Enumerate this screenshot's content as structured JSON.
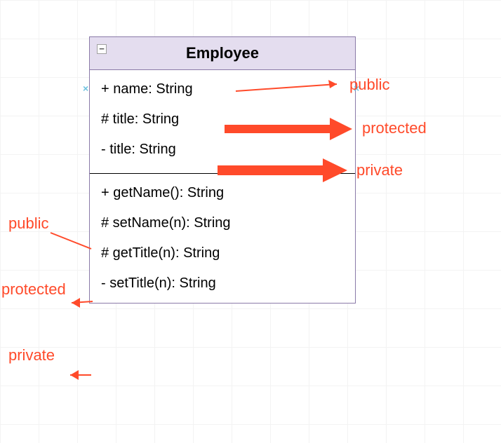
{
  "class": {
    "name": "Employee",
    "attributes": [
      {
        "text": "+ name: String"
      },
      {
        "text": "# title: String"
      },
      {
        "text": "- title: String"
      }
    ],
    "methods": [
      {
        "text": "+ getName(): String"
      },
      {
        "text": "# setName(n): String"
      },
      {
        "text": "# getTitle(n): String"
      },
      {
        "text": "- setTitle(n): String"
      }
    ]
  },
  "annotations": {
    "right": {
      "public": "public",
      "protected": "protected",
      "private": "private"
    },
    "left": {
      "public": "public",
      "protected": "protected",
      "private": "private"
    }
  },
  "collapse_glyph": "−",
  "handle_glyph_left": "×",
  "handle_glyph_right": "×"
}
